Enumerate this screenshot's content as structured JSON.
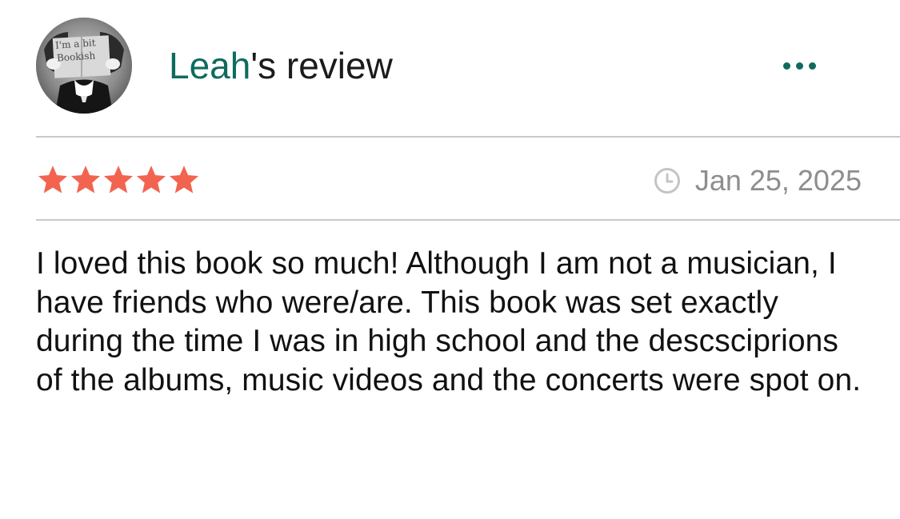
{
  "review": {
    "reviewer_name": "Leah",
    "title_suffix": "'s review",
    "avatar": {
      "icon": "avatar-photo",
      "caption_line1": "I'm a bit",
      "caption_line2": "Bookish"
    },
    "more_icon": "ellipsis-icon",
    "rating": {
      "value": 5,
      "max": 5,
      "color": "#f26450"
    },
    "date_icon": "clock-icon",
    "date": "Jan 25, 2025",
    "text": "I loved this book so much! Although I am not a musician, I have friends who were/are. This book was set exactly during the time I was in high school and the descsciprions of the albums, music videos and the concerts were spot on."
  },
  "colors": {
    "accent": "#0e6b5e",
    "star": "#f26450",
    "muted": "#8e8e8e",
    "divider": "#c9c9c9"
  }
}
